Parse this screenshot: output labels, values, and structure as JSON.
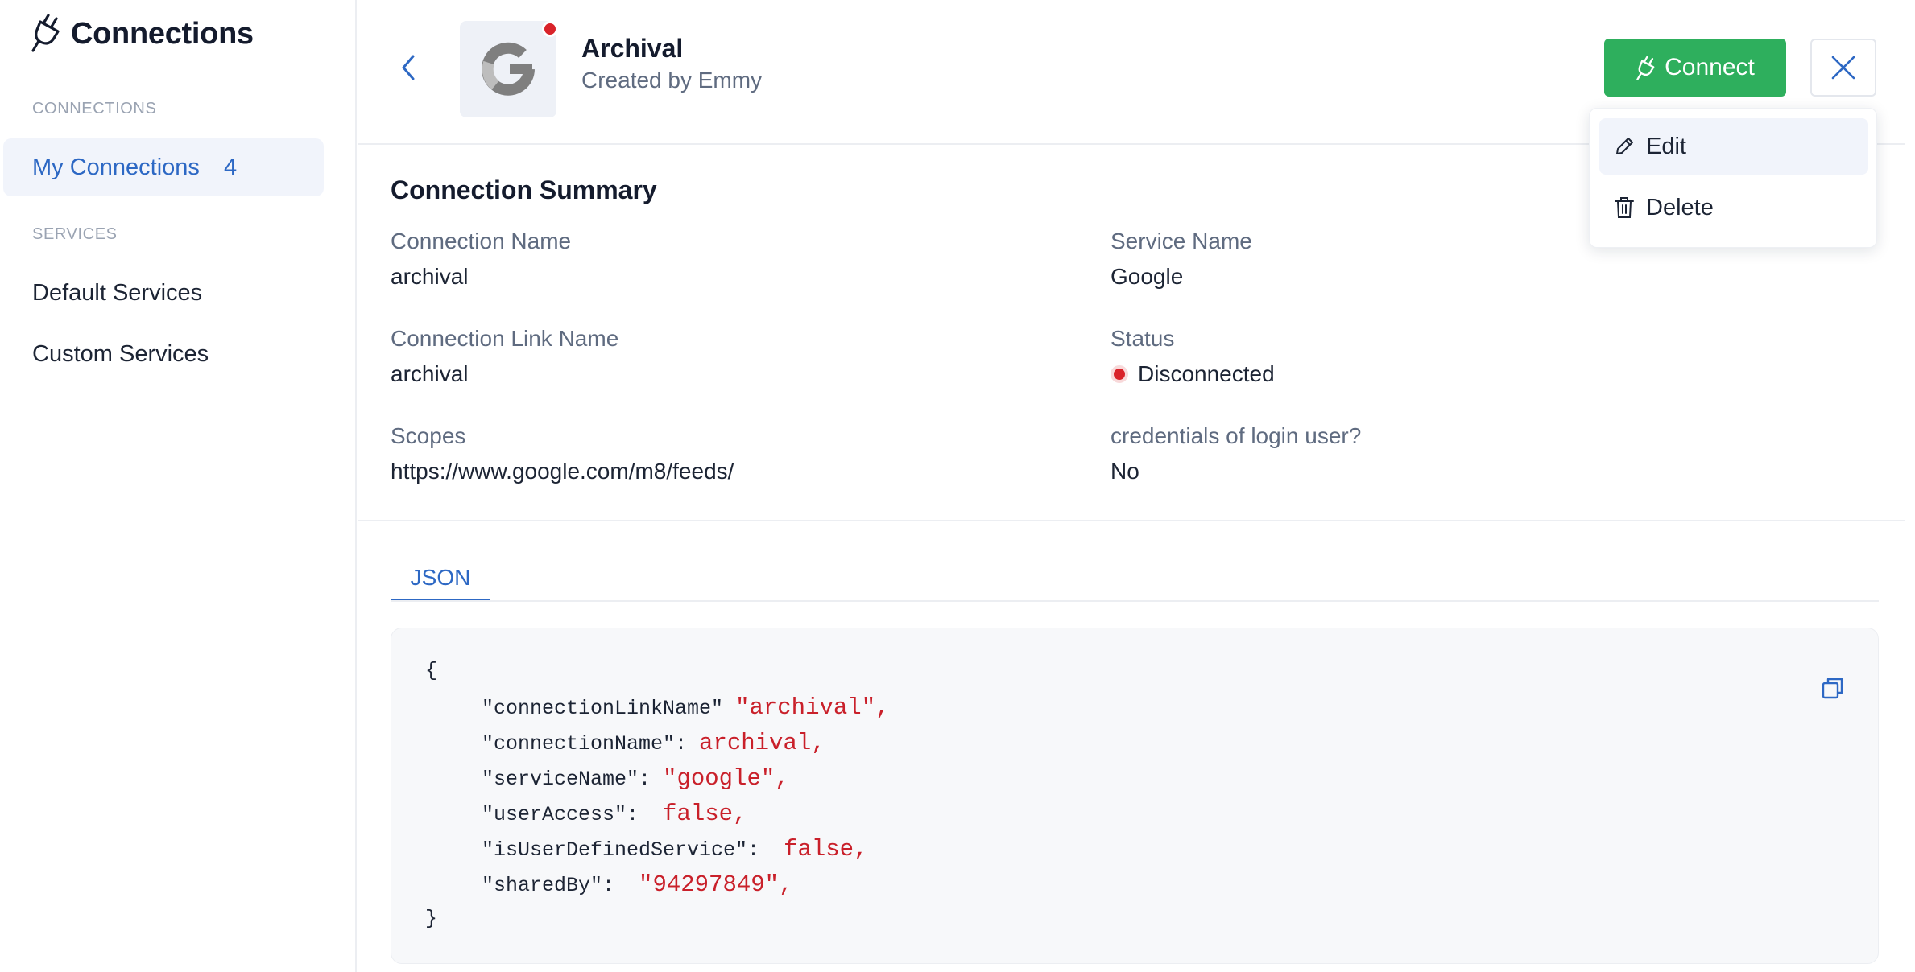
{
  "sidebar": {
    "title": "Connections",
    "sections": [
      {
        "label": "CONNECTIONS"
      },
      {
        "label": "SERVICES"
      }
    ],
    "items": [
      {
        "label": "My Connections",
        "count": "4",
        "active": true
      },
      {
        "label": "Default Services"
      },
      {
        "label": "Custom Services"
      }
    ]
  },
  "header": {
    "name": "Archival",
    "created_by": "Created by Emmy",
    "connect_label": "Connect"
  },
  "menu": {
    "items": [
      {
        "label": "Edit",
        "icon": "pencil-icon"
      },
      {
        "label": "Delete",
        "icon": "trash-icon"
      }
    ]
  },
  "summary": {
    "title": "Connection Summary",
    "fields": [
      {
        "label": "Connection Name",
        "value": "archival"
      },
      {
        "label": "Service Name",
        "value": "Google"
      },
      {
        "label": "Connection Link Name",
        "value": "archival"
      },
      {
        "label": "Status",
        "value": "Disconnected"
      },
      {
        "label": "Scopes",
        "value": "https://www.google.com/m8/feeds/"
      },
      {
        "label": "credentials of login user?",
        "value": "No"
      }
    ]
  },
  "tabs": [
    {
      "label": "JSON"
    }
  ],
  "json_view": {
    "open": "{",
    "close": "}",
    "lines": [
      {
        "key": "\"connectionLinkName\" ",
        "value": "\"archival\","
      },
      {
        "key": "\"connectionName\": ",
        "value": "archival,"
      },
      {
        "key": "\"serviceName\": ",
        "value": "\"google\","
      },
      {
        "key": "\"userAccess\":  ",
        "value": "false,"
      },
      {
        "key": "\"isUserDefinedService\":  ",
        "value": "false,"
      },
      {
        "key": "\"sharedBy\":  ",
        "value": "\"94297849\","
      }
    ]
  },
  "colors": {
    "accent": "#2d68c4",
    "connect": "#2eaf5d",
    "error": "#d9232a"
  }
}
